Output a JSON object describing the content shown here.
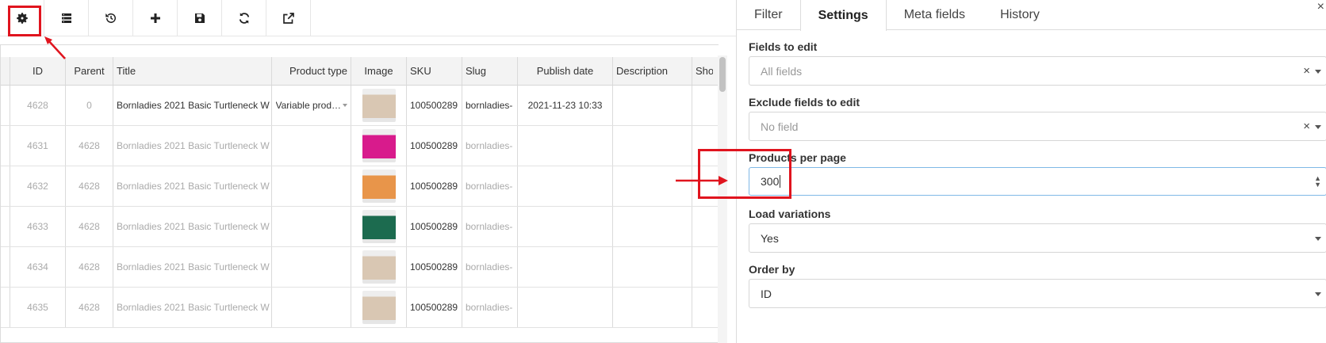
{
  "toolbar": {
    "buttons": [
      {
        "name": "settings",
        "icon": "gear-icon"
      },
      {
        "name": "columns",
        "icon": "list-icon"
      },
      {
        "name": "history",
        "icon": "history-icon"
      },
      {
        "name": "add",
        "icon": "plus-icon"
      },
      {
        "name": "save",
        "icon": "save-icon"
      },
      {
        "name": "reload",
        "icon": "refresh-icon"
      },
      {
        "name": "export",
        "icon": "external-link-icon"
      }
    ]
  },
  "grid": {
    "headers": {
      "id": "ID",
      "parent": "Parent",
      "title": "Title",
      "product_type": "Product type",
      "image": "Image",
      "sku": "SKU",
      "slug": "Slug",
      "publish_date": "Publish date",
      "description": "Description",
      "short": "Sho"
    },
    "rows": [
      {
        "id": "4628",
        "parent": "0",
        "title": "Bornladies 2021 Basic Turtleneck W",
        "product_type": "Variable prod…",
        "sku": "100500289",
        "slug": "bornladies-",
        "publish_date": "2021-11-23 10:33",
        "thumb_color": "#d9c7b3"
      },
      {
        "id": "4631",
        "parent": "4628",
        "title": "Bornladies 2021 Basic Turtleneck W",
        "product_type": "",
        "sku": "100500289",
        "slug": "bornladies-",
        "publish_date": "",
        "thumb_color": "#d81b8c"
      },
      {
        "id": "4632",
        "parent": "4628",
        "title": "Bornladies 2021 Basic Turtleneck W",
        "product_type": "",
        "sku": "100500289",
        "slug": "bornladies-",
        "publish_date": "",
        "thumb_color": "#e8954a"
      },
      {
        "id": "4633",
        "parent": "4628",
        "title": "Bornladies 2021 Basic Turtleneck W",
        "product_type": "",
        "sku": "100500289",
        "slug": "bornladies-",
        "publish_date": "",
        "thumb_color": "#1c6b4f"
      },
      {
        "id": "4634",
        "parent": "4628",
        "title": "Bornladies 2021 Basic Turtleneck W",
        "product_type": "",
        "sku": "100500289",
        "slug": "bornladies-",
        "publish_date": "",
        "thumb_color": "#d9c7b3"
      },
      {
        "id": "4635",
        "parent": "4628",
        "title": "Bornladies 2021 Basic Turtleneck W",
        "product_type": "",
        "sku": "100500289",
        "slug": "bornladies-",
        "publish_date": "",
        "thumb_color": "#d9c7b3"
      }
    ]
  },
  "panel": {
    "tabs": [
      "Filter",
      "Settings",
      "Meta fields",
      "History"
    ],
    "active_tab": "Settings",
    "close_label": "×",
    "fields_to_edit": {
      "label": "Fields to edit",
      "placeholder": "All fields",
      "clear": "×"
    },
    "exclude_fields": {
      "label": "Exclude fields to edit",
      "placeholder": "No field",
      "clear": "×"
    },
    "products_per_page": {
      "label": "Products per page",
      "value": "300"
    },
    "load_variations": {
      "label": "Load variations",
      "value": "Yes"
    },
    "order_by": {
      "label": "Order by",
      "value": "ID"
    }
  },
  "colors": {
    "highlight": "#e0141e",
    "focus_border": "#7fb8e6"
  }
}
